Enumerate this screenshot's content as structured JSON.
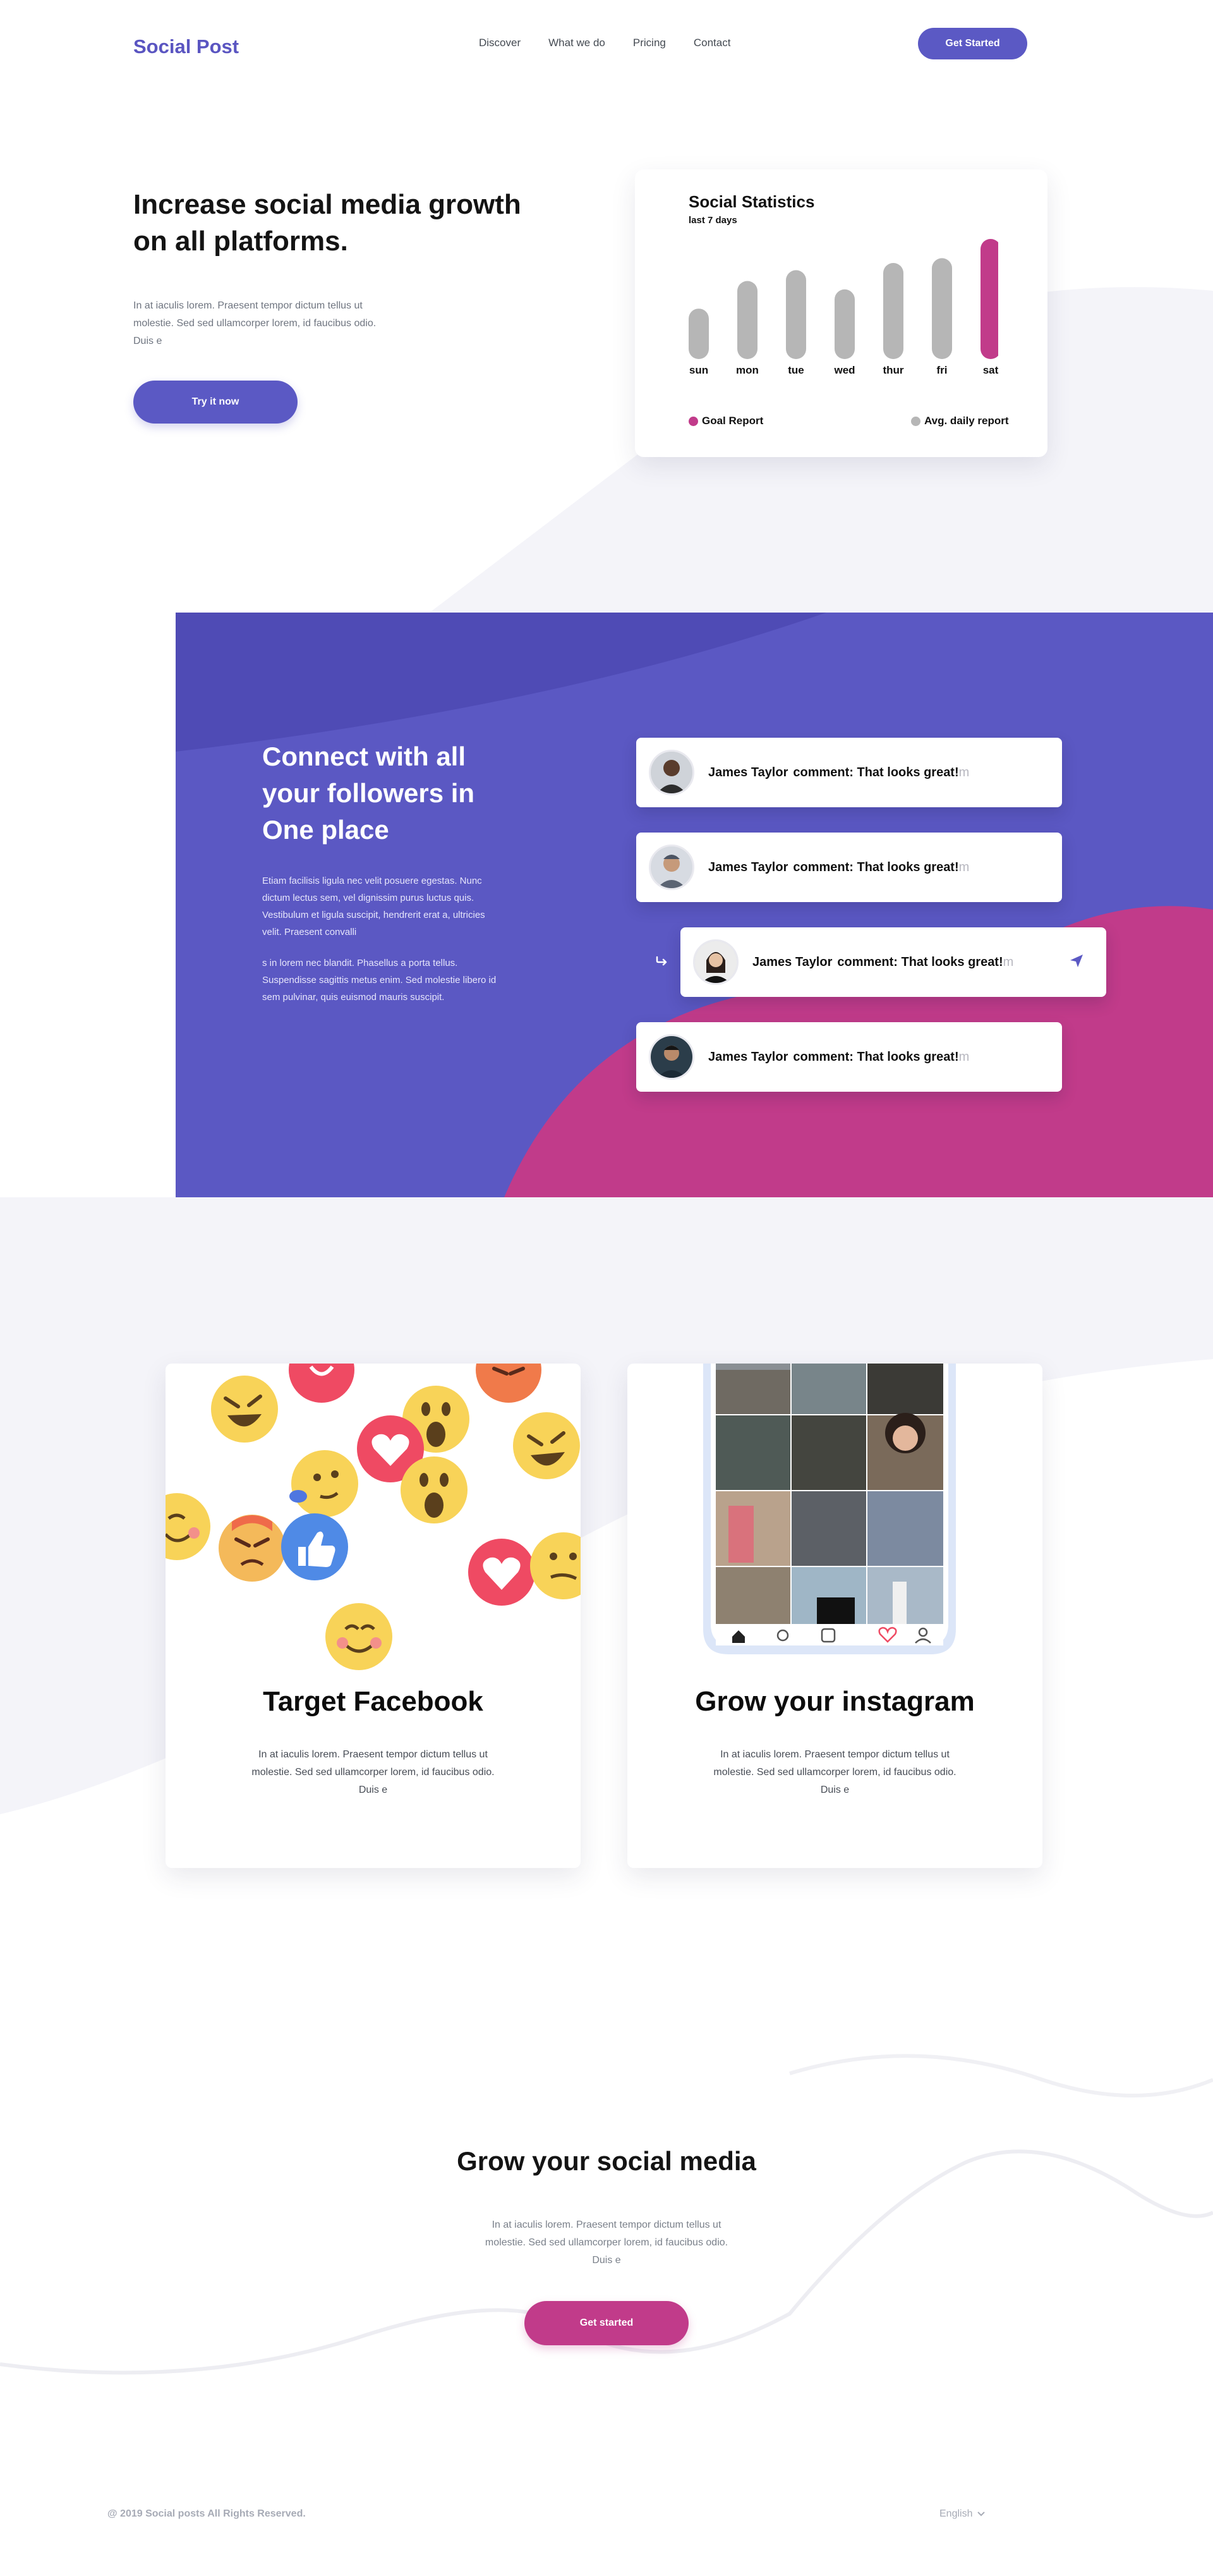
{
  "nav": {
    "logo": "Social Post",
    "links": [
      "Discover",
      "What we do",
      "Pricing",
      "Contact"
    ],
    "cta": "Get Started"
  },
  "hero": {
    "title": "Increase social media growth on all platforms.",
    "text": "In at iaculis lorem. Praesent tempor dictum tellus ut molestie. Sed sed ullamcorper lorem, id faucibus odio. Duis e",
    "button": "Try it now"
  },
  "stats": {
    "title": "Social Statistics",
    "subtitle": "last 7 days",
    "legend_goal": "Goal Report",
    "legend_avg": "Avg. daily report",
    "colors": {
      "bar": "#b6b6b6",
      "goal": "#c13b8a"
    }
  },
  "chart_data": {
    "type": "bar",
    "title": "Social Statistics",
    "subtitle": "last 7 days",
    "categories": [
      "sun",
      "mon",
      "tue",
      "wed",
      "thur",
      "fri",
      "sat"
    ],
    "values": [
      42,
      65,
      74,
      58,
      80,
      84,
      100
    ],
    "highlight": "sat",
    "ylim": [
      0,
      100
    ],
    "legend": [
      "Goal Report",
      "Avg. daily report"
    ],
    "legend_position": "bottom",
    "grid": false
  },
  "connect": {
    "title": "Connect with all your followers in One place",
    "para1": "Etiam facilisis ligula nec velit posuere egestas. Nunc dictum lectus sem, vel dignissim purus luctus quis. Vestibulum et ligula suscipit, hendrerit erat a, ultricies velit. Praesent convalli",
    "para2": "s in lorem nec blandit. Phasellus a porta tellus. Suspendisse sagittis metus enim. Sed molestie libero id sem pulvinar, quis euismod mauris suscipit.",
    "comments": [
      {
        "name": "James Taylor",
        "message": "comment: That looks great!",
        "trail": "m"
      },
      {
        "name": "James Taylor",
        "message": "comment: That looks great!",
        "trail": "m"
      },
      {
        "name": "James Taylor",
        "message": "comment: That looks great!",
        "trail": "m"
      },
      {
        "name": "James Taylor",
        "message": "comment: That looks great!",
        "trail": "m"
      }
    ]
  },
  "cards": {
    "facebook": {
      "title": "Target Facebook",
      "text": "In at iaculis lorem. Praesent tempor dictum tellus ut molestie. Sed sed ullamcorper lorem, id faucibus odio. Duis e"
    },
    "instagram": {
      "title": "Grow your instagram",
      "text": "In at iaculis lorem. Praesent tempor dictum tellus ut molestie. Sed sed ullamcorper lorem, id faucibus odio. Duis e"
    }
  },
  "cta": {
    "title": "Grow your social media",
    "text": "In at iaculis lorem. Praesent tempor dictum tellus ut molestie. Sed sed ullamcorper lorem, id faucibus odio. Duis e",
    "button": "Get started"
  },
  "footer": {
    "copyright": "@ 2019 Social posts All Rights Reserved.",
    "language": "English"
  }
}
